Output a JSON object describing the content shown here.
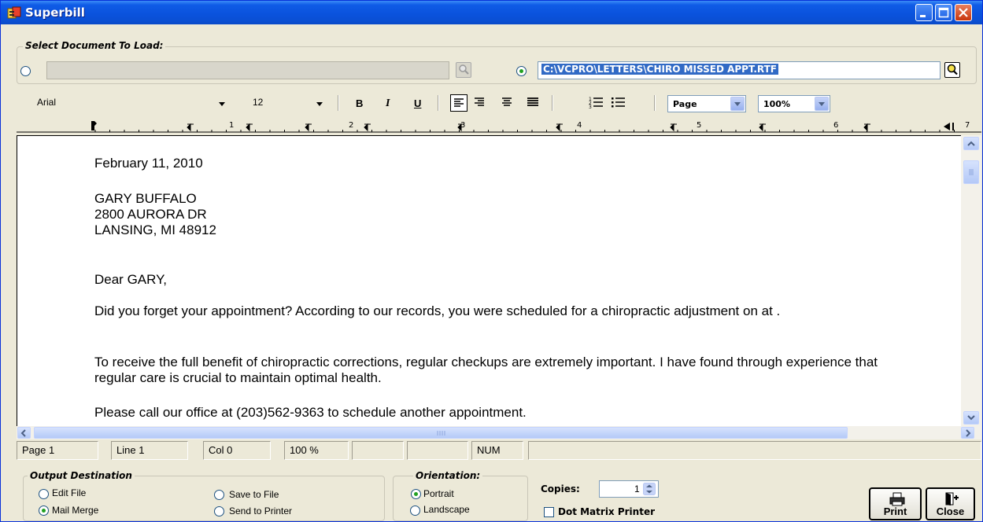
{
  "window": {
    "title": "Superbill"
  },
  "load": {
    "group_label": "Select Document To Load:",
    "left_field_value": "",
    "path_value": "C:\\VCPRO\\LETTERS\\CHIRO MISSED APPT.RTF",
    "left_selected": false,
    "path_selected": true
  },
  "toolbar": {
    "font_name": "Arial",
    "font_size": "12",
    "bold": "B",
    "italic": "I",
    "underline": "U",
    "view_mode": "Page",
    "zoom": "100%"
  },
  "ruler": {
    "marks": [
      "1",
      "2",
      "3",
      "4",
      "5",
      "6",
      "7"
    ]
  },
  "document": {
    "date": "February 11, 2010",
    "address": [
      "GARY BUFFALO",
      "2800 AURORA DR",
      "LANSING, MI  48912"
    ],
    "salutation": "Dear GARY,",
    "paragraphs": [
      "Did you forget your appointment?  According to our records, you were scheduled for a chiropractic adjustment on   at  .",
      "To receive the full benefit of chiropractic corrections, regular checkups are extremely important.  I have found through experience that regular care is crucial to maintain optimal health.",
      "Please call our office at (203)562-9363 to schedule another appointment."
    ]
  },
  "status": {
    "page": "Page  1",
    "line": "Line  1",
    "col": "Col  0",
    "zoom": "100 %",
    "num": "NUM"
  },
  "output": {
    "group_label": "Output Destination",
    "edit_file": "Edit File",
    "mail_merge": "Mail Merge",
    "save_to_file": "Save to File",
    "send_to_printer": "Send to Printer",
    "selected": "Mail Merge"
  },
  "orientation": {
    "group_label": "Orientation:",
    "portrait": "Portrait",
    "landscape": "Landscape",
    "selected": "Portrait"
  },
  "copies": {
    "label": "Copies:",
    "value": "1"
  },
  "dot_matrix": {
    "label": "Dot Matrix Printer",
    "checked": false
  },
  "buttons": {
    "print": "Print",
    "close": "Close"
  },
  "colors": {
    "titlebar": "#0a52dc",
    "selection": "#316ac5",
    "radio_dot": "#21a121"
  }
}
